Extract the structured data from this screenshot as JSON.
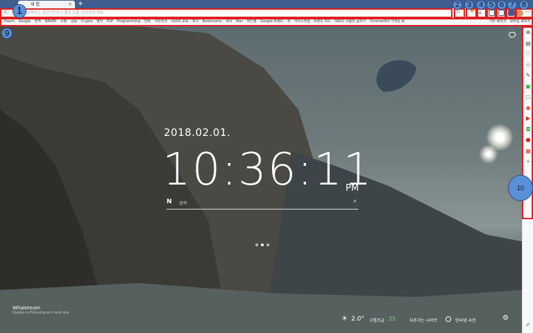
{
  "tab": {
    "title": "새 탭",
    "close": "×",
    "new_tab": "+"
  },
  "toolbar": {
    "back": "<",
    "omnibox_placeholder": "검색하고 싶은 단어나 웹주소를 입력해주세요.",
    "reload": "↻",
    "star": "★",
    "download": "⤓",
    "more": "⋯"
  },
  "bookmarks": {
    "items": [
      "Daum",
      "Google",
      "번역",
      "NAVER",
      "쇼핑",
      "금융",
      "Crypto",
      "영어",
      "P2P",
      "Programming",
      "만화",
      "이것저것",
      "UI/UX 교육",
      "직구",
      "Bookmarks",
      "회사",
      "Mac",
      "파인썸",
      "Google 트렌드",
      "직",
      "아이스착탈 - 트렌드 피드",
      "SRDC 스팀잇 글쓰기",
      "Chrome에서 가져온 북"
    ],
    "right": [
      "기타 북마크",
      "모바일 북마크"
    ]
  },
  "clock": {
    "date": "2018.02.01.",
    "time": "10:36:11",
    "ampm": "PM"
  },
  "search": {
    "logo": "N",
    "placeholder": "검색",
    "button": "⌕"
  },
  "brand": {
    "name": "Whaleteam",
    "sub": "Double is Pinturing as it and one"
  },
  "footer": {
    "weather_icon": "☀",
    "temperature": "2.0°",
    "condition": "구름조금",
    "gauge": "25",
    "frequent_sites": "자주가는 사이트",
    "history": "인터넷 사전",
    "settings_icon": "⚙"
  },
  "sidebar": {
    "items": [
      {
        "name": "zoom",
        "glyph": "⊕",
        "color": "#555555"
      },
      {
        "name": "reader",
        "glyph": "▤",
        "color": "#555555"
      },
      {
        "name": "favorites",
        "glyph": "♡",
        "color": "#555555"
      },
      {
        "name": "bookmark",
        "glyph": "☆",
        "color": "#555555"
      },
      {
        "name": "translate",
        "glyph": "✎",
        "color": "#555555"
      },
      {
        "name": "green-app",
        "glyph": "▣",
        "color": "#2eaa4a"
      },
      {
        "name": "notes",
        "glyph": "▢",
        "color": "#2eaa4a"
      },
      {
        "name": "red-app",
        "glyph": "◉",
        "color": "#e03a3a"
      },
      {
        "name": "youtube",
        "glyph": "▶",
        "color": "#e02020"
      },
      {
        "name": "line",
        "glyph": "◘",
        "color": "#2eaa4a"
      },
      {
        "name": "record",
        "glyph": "●",
        "color": "#e02020"
      },
      {
        "name": "calendar",
        "glyph": "▦",
        "color": "#e03a3a"
      },
      {
        "name": "add",
        "glyph": "+",
        "color": "#777777"
      }
    ],
    "edit": "✐"
  },
  "annotations": [
    "1",
    "2",
    "3",
    "4",
    "5",
    "6",
    "7",
    "8",
    "9",
    "10"
  ],
  "colors": {
    "accent": "#3f5d8f",
    "annotation_red": "#e02020",
    "annotation_badge": "#5b8fd6"
  }
}
